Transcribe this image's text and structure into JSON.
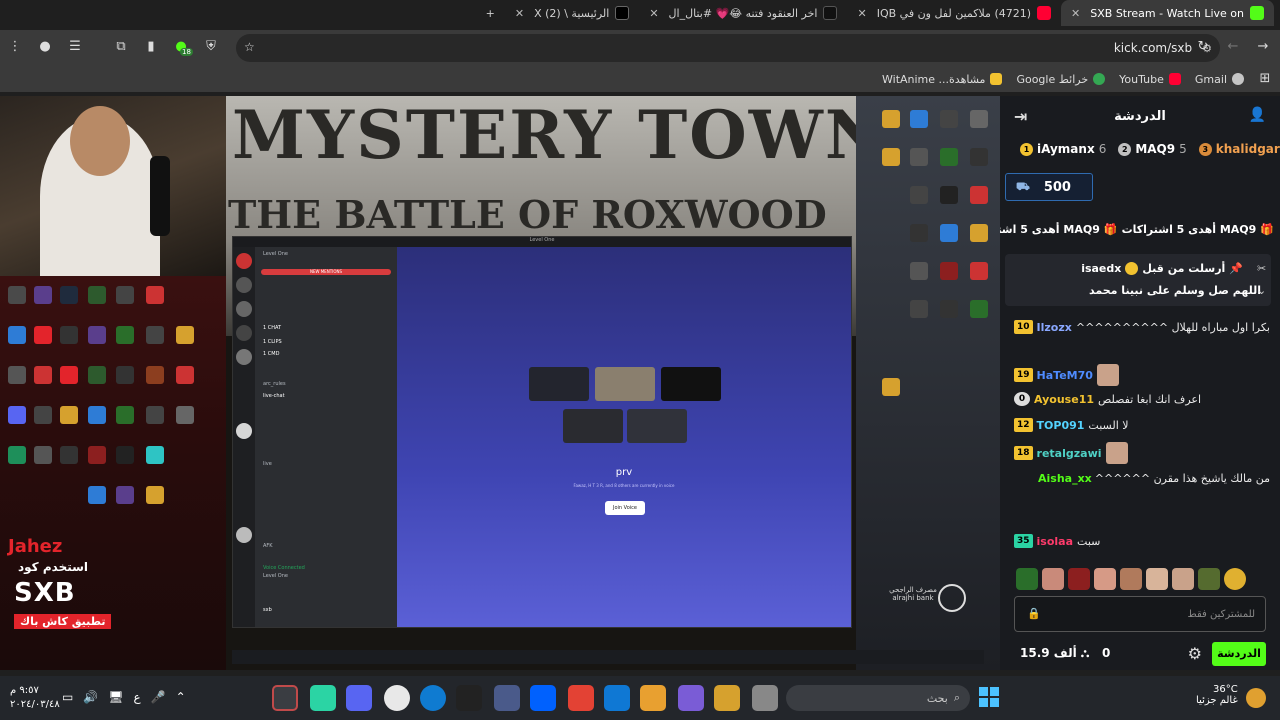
{
  "browser": {
    "tabs": [
      {
        "label": "SXB Stream - Watch Live on",
        "active": true,
        "favicon_color": "#53fc18"
      },
      {
        "label": "(4721) ملاكمين لفل ون في IQB",
        "active": false,
        "favicon_color": "#ff0033"
      },
      {
        "label": "اخر العنقود فتنه 😂💗 #بتال_ال",
        "active": false,
        "favicon_color": "#111111"
      },
      {
        "label": "الرئيسية \\ X (2)",
        "active": false,
        "favicon_color": "#000000"
      }
    ],
    "new_tab": "+",
    "url": "kick.com/sxb",
    "bookmarks": [
      "Gmail",
      "YouTube",
      "خرائط Google",
      "مشاهدة... WitAnime"
    ],
    "extension_badge": "18"
  },
  "stream": {
    "title_line1": "MYSTERY TOWN",
    "title_line2": "THE BATTLE OF ROXWOOD",
    "discord_title": "Level One",
    "discord_channels": [
      "NEW MENTIONS",
      "1 CHAT",
      "1 CLIPS",
      "1 CMD",
      "arc_rules",
      "live-chat",
      "live",
      "AFK"
    ],
    "voice_connected": "Voice Connected",
    "voice_sub": "Level One",
    "discord_user": "sxb",
    "voice_channel_name": "prv",
    "voice_channel_desc": "Fawaz, H T 3 R, and 8 others are currently in voice",
    "join_voice": "Join Voice",
    "overlay_brand": "Jahez",
    "overlay_line": "استخدم كود",
    "overlay_code": "SXB",
    "overlay_tag": "تطبيق كاش باك",
    "bank_label": "مصرف الراجحي\nalrajhi bank"
  },
  "chat": {
    "header": "الدردشة",
    "top_gifters": [
      {
        "name": "khalidgar",
        "count": "",
        "rank": "3",
        "color": "#d98b3a"
      },
      {
        "name": "MAQ9",
        "count": "5",
        "rank": "2",
        "color": "#c0c0c0"
      },
      {
        "name": "iAymanx",
        "count": "6",
        "rank": "1",
        "color": "#f2c230"
      }
    ],
    "pinned_amount": "500",
    "sub_banner": "MAQ9 أهدى 5 اشتراكات",
    "pinned_user": "isaedx",
    "pinned_prefix": "أرسلت من قبل",
    "pinned_text": "اللهم صل وسلم على نبينا محمد",
    "messages": [
      {
        "badge": "10",
        "badge_color": "#f2c230",
        "user": "Ilzozx",
        "color": "#8aa8ff",
        "text": "بكرا اول مباراه للهلال ^^^^^^^^^^^^^^^^^^^^^^^^^^^^^^^^^^^^^^^^^^^^^^^^^^^^^^^^^^^"
      },
      {
        "badge": "19",
        "badge_color": "#f2c230",
        "user": "HaTeM70",
        "color": "#4f8cff",
        "text": ""
      },
      {
        "badge": "0",
        "badge_color": "#dddddd",
        "user": "Ayouse11",
        "color": "#f2c230",
        "text": "اعرف انك ابغا تفصلص"
      },
      {
        "badge": "12",
        "badge_color": "#f2c230",
        "user": "TOP091",
        "color": "#53d3ff",
        "text": "لا السبت"
      },
      {
        "badge": "18",
        "badge_color": "#f2c230",
        "user": "retalgzawi",
        "color": "#4fd1c5",
        "text": ""
      },
      {
        "badge": "",
        "badge_color": "",
        "user": "Aisha_xx",
        "color": "#53fc18",
        "text": "من مالك ياشيخ هذا مقرن ^^^^^^^^^^^^^^^^^^^^^^^^^^^^^^^^^^^^^^^^^^^^^^^^^^^^^^^^^^^^"
      },
      {
        "badge": "35",
        "badge_color": "#2bd4a4",
        "user": "isolaa",
        "color": "#ff3b6b",
        "text": "سبت"
      }
    ],
    "input_placeholder": "للمشتركين فقط",
    "send_label": "الدردشة",
    "viewer_count": "15.9 ألف",
    "zero": "0"
  },
  "taskbar": {
    "search_placeholder": "بحث",
    "weather_temp": "36°C",
    "weather_desc": "غالم جزئيا",
    "time": "٩:٥٧ م",
    "date": "٢٠٢٤/٠٣/٤٨",
    "lang": "ع"
  }
}
